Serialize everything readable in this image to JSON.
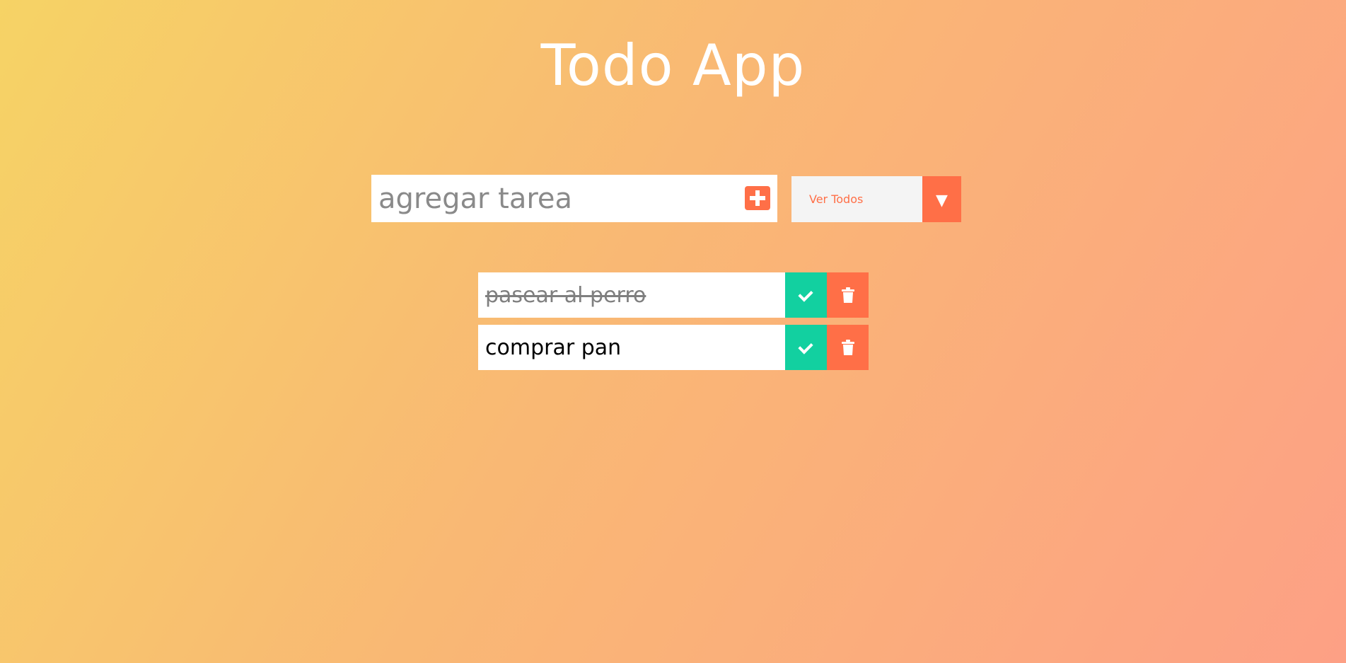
{
  "app": {
    "title": "Todo App"
  },
  "add_form": {
    "placeholder": "agregar tarea",
    "add_icon": "plus-icon"
  },
  "filter": {
    "selected": "Ver Todos",
    "arrow": "▼"
  },
  "todos": [
    {
      "text": "pasear al perro",
      "completed": true
    },
    {
      "text": "comprar pan",
      "completed": false
    }
  ],
  "colors": {
    "accent": "#ff6f47",
    "check": "#12d0a0",
    "gradient_start": "#f6d365",
    "gradient_end": "#fda085"
  }
}
